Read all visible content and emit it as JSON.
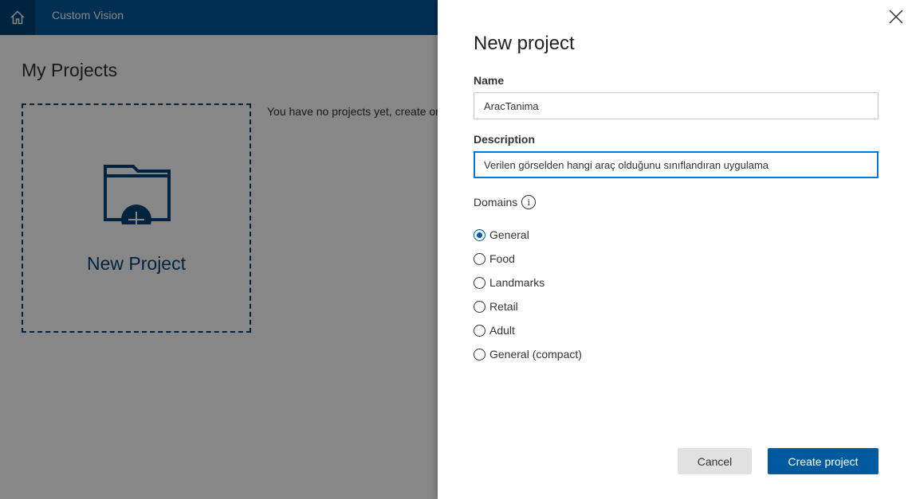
{
  "header": {
    "app_title": "Custom Vision",
    "home_icon": "home-icon"
  },
  "page": {
    "title": "My Projects",
    "new_project_tile_label": "New Project",
    "empty_message": "You have no projects yet, create on"
  },
  "panel": {
    "title": "New project",
    "name": {
      "label": "Name",
      "value": "AracTanima"
    },
    "description": {
      "label": "Description",
      "value": "Verilen görselden hangi araç olduğunu sınıflandıran uygulama"
    },
    "domains": {
      "label": "Domains",
      "info_glyph": "i",
      "options": [
        {
          "label": "General",
          "selected": true
        },
        {
          "label": "Food",
          "selected": false
        },
        {
          "label": "Landmarks",
          "selected": false
        },
        {
          "label": "Retail",
          "selected": false
        },
        {
          "label": "Adult",
          "selected": false
        },
        {
          "label": "General (compact)",
          "selected": false
        }
      ]
    },
    "cancel_label": "Cancel",
    "create_label": "Create project"
  },
  "colors": {
    "brand_blue": "#005a9e",
    "brand_dark": "#004578",
    "focus_blue": "#0078d4"
  }
}
